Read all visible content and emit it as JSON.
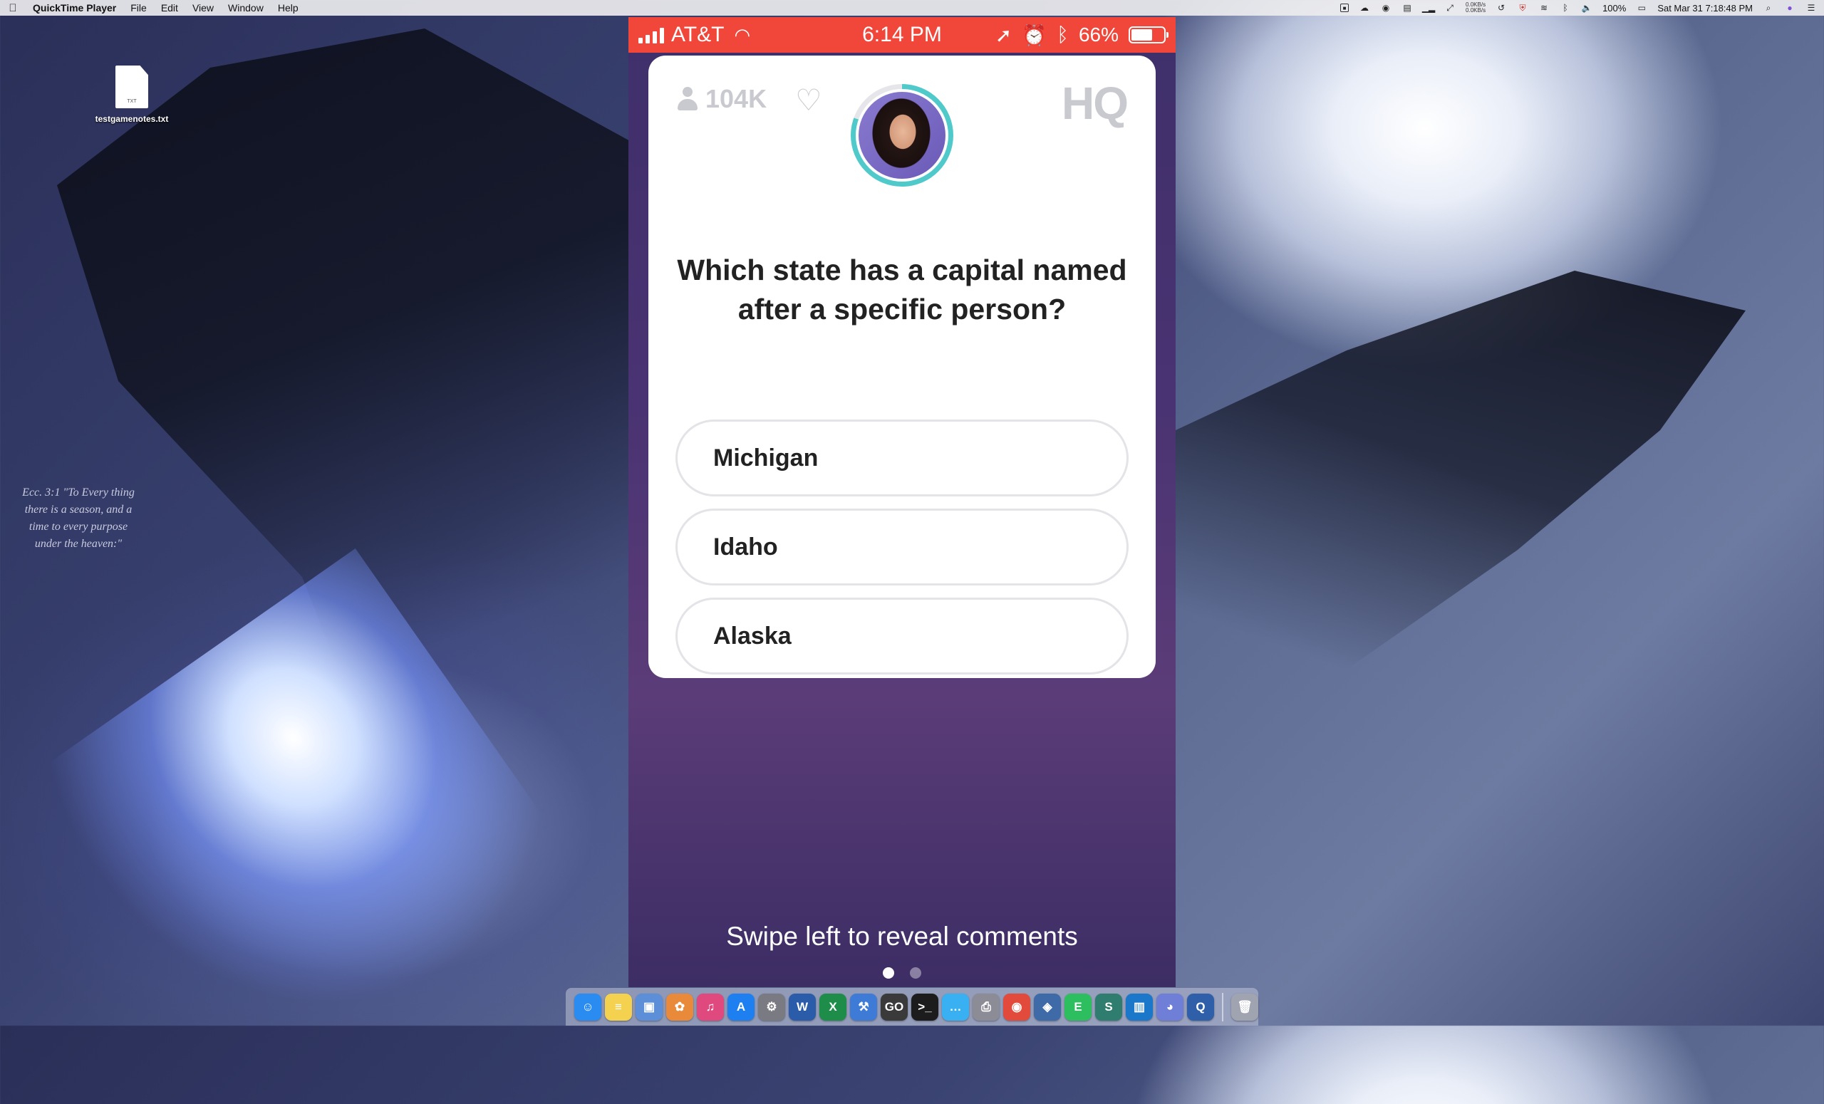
{
  "menubar": {
    "app_name": "QuickTime Player",
    "menus": [
      "File",
      "Edit",
      "View",
      "Window",
      "Help"
    ],
    "net_up": "0.0KB/s",
    "net_down": "0.0KB/s",
    "battery": "100%",
    "datetime": "Sat Mar 31  7:18:48 PM"
  },
  "desktop": {
    "file_name": "testgamenotes.txt",
    "file_ext": "TXT",
    "verse": "Ecc. 3:1 \"To Every thing there is a season, and a time to every purpose under the heaven:\""
  },
  "phone": {
    "status": {
      "carrier": "AT&T",
      "time": "6:14 PM",
      "battery": "66%",
      "battery_level": 0.66
    },
    "viewers": "104K",
    "logo": "HQ",
    "question": "Which state has a capital named after a specific person?",
    "answers": [
      "Michigan",
      "Idaho",
      "Alaska"
    ],
    "swipe_hint": "Swipe left to reveal comments",
    "page_dots": {
      "count": 2,
      "active": 0
    }
  },
  "dock": {
    "apps": [
      {
        "name": "Finder",
        "color": "#2a8cf0",
        "glyph": "☺"
      },
      {
        "name": "Notes",
        "color": "#f4d14e",
        "glyph": "≡"
      },
      {
        "name": "Preview",
        "color": "#5d8fd8",
        "glyph": "▣"
      },
      {
        "name": "Photos",
        "color": "#e98a3b",
        "glyph": "✿"
      },
      {
        "name": "iTunes",
        "color": "#e0497e",
        "glyph": "♫"
      },
      {
        "name": "App Store",
        "color": "#1e7ff0",
        "glyph": "A"
      },
      {
        "name": "System Preferences",
        "color": "#7a7a82",
        "glyph": "⚙"
      },
      {
        "name": "Word",
        "color": "#2b5caa",
        "glyph": "W"
      },
      {
        "name": "Excel",
        "color": "#1f8d4a",
        "glyph": "X"
      },
      {
        "name": "Xcode",
        "color": "#3e7bd6",
        "glyph": "⚒"
      },
      {
        "name": "CS:GO",
        "color": "#3a3a3a",
        "glyph": "GO"
      },
      {
        "name": "Terminal",
        "color": "#1c1c1c",
        "glyph": ">_"
      },
      {
        "name": "Messages",
        "color": "#38b0f2",
        "glyph": "…"
      },
      {
        "name": "Printer",
        "color": "#8c8c96",
        "glyph": "⎙"
      },
      {
        "name": "Chrome",
        "color": "#e24a3b",
        "glyph": "◉"
      },
      {
        "name": "VirtualBox",
        "color": "#3f6aa8",
        "glyph": "◈"
      },
      {
        "name": "Evernote",
        "color": "#2dbe60",
        "glyph": "E"
      },
      {
        "name": "Scrivener",
        "color": "#2e7d6e",
        "glyph": "S"
      },
      {
        "name": "Trello",
        "color": "#1a77c9",
        "glyph": "▥"
      },
      {
        "name": "Discord",
        "color": "#6f7fd8",
        "glyph": "◕"
      },
      {
        "name": "QuickTime",
        "color": "#2f5fa8",
        "glyph": "Q"
      },
      {
        "name": "Trash",
        "color": "#a0a4b0",
        "glyph": "🗑"
      }
    ]
  }
}
